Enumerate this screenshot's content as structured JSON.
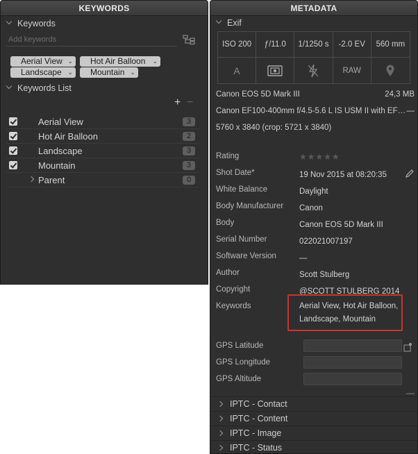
{
  "keywords_panel": {
    "title": "KEYWORDS",
    "section_keywords": "Keywords",
    "input_placeholder": "Add keywords",
    "tags": [
      "Aerial View",
      "Hot Air Balloon",
      "Landscape",
      "Mountain"
    ],
    "section_list": "Keywords List",
    "add_label": "+",
    "remove_label": "−",
    "list": [
      {
        "label": "Aerial View",
        "count": "3"
      },
      {
        "label": "Hot Air Balloon",
        "count": "2"
      },
      {
        "label": "Landscape",
        "count": "3"
      },
      {
        "label": "Mountain",
        "count": "3"
      },
      {
        "label": "Parent",
        "count": "0"
      }
    ]
  },
  "metadata_panel": {
    "title": "METADATA",
    "section_exif": "Exif",
    "exif_top": [
      "ISO 200",
      "ƒ/11.0",
      "1/1250 s",
      "-2.0 EV",
      "560 mm"
    ],
    "exif_bottom": [
      "A",
      "metering-icon",
      "flash-off-icon",
      "RAW",
      "location-pin-icon"
    ],
    "camera": "Canon EOS 5D Mark III",
    "file_size": "24,3 MB",
    "lens": "Canon EF100-400mm f/4.5-5.6 L IS USM II with EF…",
    "lens_extra": "—",
    "dimensions": "5760 x 3840 (crop: 5721 x 3840)",
    "fields": {
      "rating_label": "Rating",
      "rating_value": "★★★★★",
      "shot_date_label": "Shot Date*",
      "shot_date_value": "19 Nov 2015 at 08:20:35",
      "white_balance_label": "White Balance",
      "white_balance_value": "Daylight",
      "body_manufacturer_label": "Body Manufacturer",
      "body_manufacturer_value": "Canon",
      "body_label": "Body",
      "body_value": "Canon EOS 5D Mark III",
      "serial_label": "Serial Number",
      "serial_value": "022021007197",
      "software_label": "Software Version",
      "software_value": "—",
      "author_label": "Author",
      "author_value": "Scott Stulberg",
      "copyright_label": "Copyright",
      "copyright_value": "@SCOTT STULBERG 2014",
      "keywords_label": "Keywords",
      "keywords_value": "Aerial View, Hot Air Balloon, Landscape, Mountain",
      "gps_lat_label": "GPS Latitude",
      "gps_lon_label": "GPS Longitude",
      "gps_alt_label": "GPS Altitude"
    },
    "iptc_sections": [
      "IPTC - Contact",
      "IPTC - Content",
      "IPTC - Image",
      "IPTC - Status"
    ],
    "colors": {
      "highlight": "#c9352d",
      "panel_bg": "#2f2f2f"
    }
  }
}
